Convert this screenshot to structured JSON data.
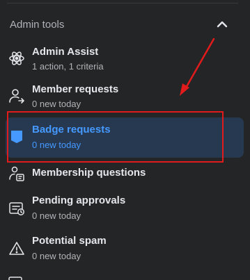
{
  "section": {
    "title": "Admin tools",
    "collapse_icon": "chevron-up-icon"
  },
  "items": [
    {
      "label": "Admin Assist",
      "sub": "1 action, 1 criteria",
      "icon": "atom-icon",
      "active": false
    },
    {
      "label": "Member requests",
      "sub": "0 new today",
      "icon": "person-arrow-icon",
      "active": false
    },
    {
      "label": "Badge requests",
      "sub": "0 new today",
      "icon": "badge-shield-icon",
      "active": true
    },
    {
      "label": "Membership questions",
      "sub": "",
      "icon": "question-card-icon",
      "active": false
    },
    {
      "label": "Pending approvals",
      "sub": "0 new today",
      "icon": "pending-card-icon",
      "active": false
    },
    {
      "label": "Potential spam",
      "sub": "0 new today",
      "icon": "warning-triangle-icon",
      "active": false
    }
  ],
  "colors": {
    "background": "#242526",
    "active_background": "#263951",
    "active_text": "#4599ff",
    "annotation": "#e11b1b"
  }
}
